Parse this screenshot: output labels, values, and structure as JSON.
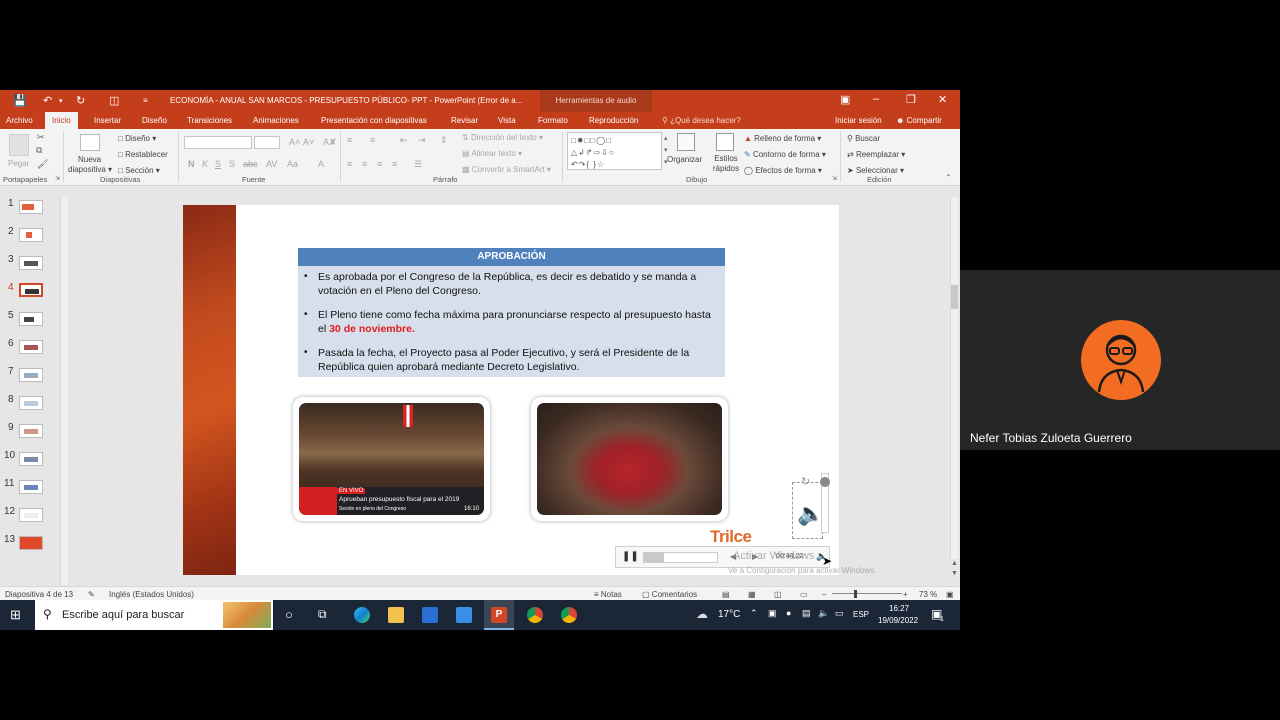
{
  "titlebar": {
    "document_title": "ECONOMÍA - ANUAL SAN MARCOS - PRESUPUESTO PÚBLICO- PPT - PowerPoint (Error de a...",
    "contextual_tab": "Herramientas de audio",
    "colors": {
      "accent": "#c43e1c"
    }
  },
  "tabs": [
    "Archivo",
    "Inicio",
    "Insertar",
    "Diseño",
    "Transiciones",
    "Animaciones",
    "Presentación con diapositivas",
    "Revisar",
    "Vista",
    "Formato",
    "Reproducción"
  ],
  "tell_me": "¿Qué desea hacer?",
  "sign_in": "Iniciar sesión",
  "share": "Compartir",
  "ribbon": {
    "paste": "Pegar",
    "new_slide": "Nueva diapositiva",
    "layout": "Diseño",
    "reset": "Restablecer",
    "section": "Sección",
    "text_direction": "Dirección del texto",
    "align_text": "Alinear texto",
    "smartart": "Convertir a SmartArt",
    "arrange": "Organizar",
    "quick_styles": "Estilos rápidos",
    "shape_fill": "Relleno de forma",
    "shape_outline": "Contorno de forma",
    "shape_effects": "Efectos de forma",
    "find": "Buscar",
    "replace": "Reemplazar",
    "select": "Seleccionar",
    "groups": {
      "clipboard": "Portapapeles",
      "slides": "Diapositivas",
      "font": "Fuente",
      "paragraph": "Párrafo",
      "drawing": "Dibujo",
      "editing": "Edición"
    }
  },
  "thumbnails": [
    "1",
    "2",
    "3",
    "4",
    "5",
    "6",
    "7",
    "8",
    "9",
    "10",
    "11",
    "12",
    "13"
  ],
  "active_slide_index": 4,
  "slide": {
    "header": "APROBACIÓN",
    "bullets": [
      {
        "text": "Es aprobada por el Congreso de la República, es decir es debatido y se manda a votación en el Pleno del Congreso."
      },
      {
        "text": "El Pleno tiene como fecha máxima para pronunciarse respecto al presupuesto hasta el ",
        "highlight": "30 de noviembre."
      },
      {
        "text": "Pasada la fecha, el Proyecto pasa al Poder Ejecutivo, y será el Presidente de la República quien aprobará mediante Decreto Legislativo."
      }
    ],
    "news_live": "EN VIVO",
    "news_headline": "Aprueban presupuesto fiscal para el 2019",
    "news_sub": "Sesión en pleno del Congreso",
    "news_time": "16:10",
    "logo": "Trilce"
  },
  "media": {
    "time": "00:44,22"
  },
  "watermark": {
    "line1": "Activar Windows",
    "line2": "Ve a Configuración para activar Windows."
  },
  "status": {
    "slide_counter": "Diapositiva 4 de 13",
    "language": "Inglés (Estados Unidos)",
    "notes": "Notas",
    "comments": "Comentarios",
    "zoom": "73 %"
  },
  "taskbar": {
    "search_placeholder": "Escribe aquí para buscar",
    "temperature": "17°C",
    "lang": "ESP",
    "time": "16:27",
    "date": "19/09/2022",
    "notification_count": "1"
  },
  "participant": {
    "name": "Nefer Tobias Zuloeta Guerrero"
  }
}
